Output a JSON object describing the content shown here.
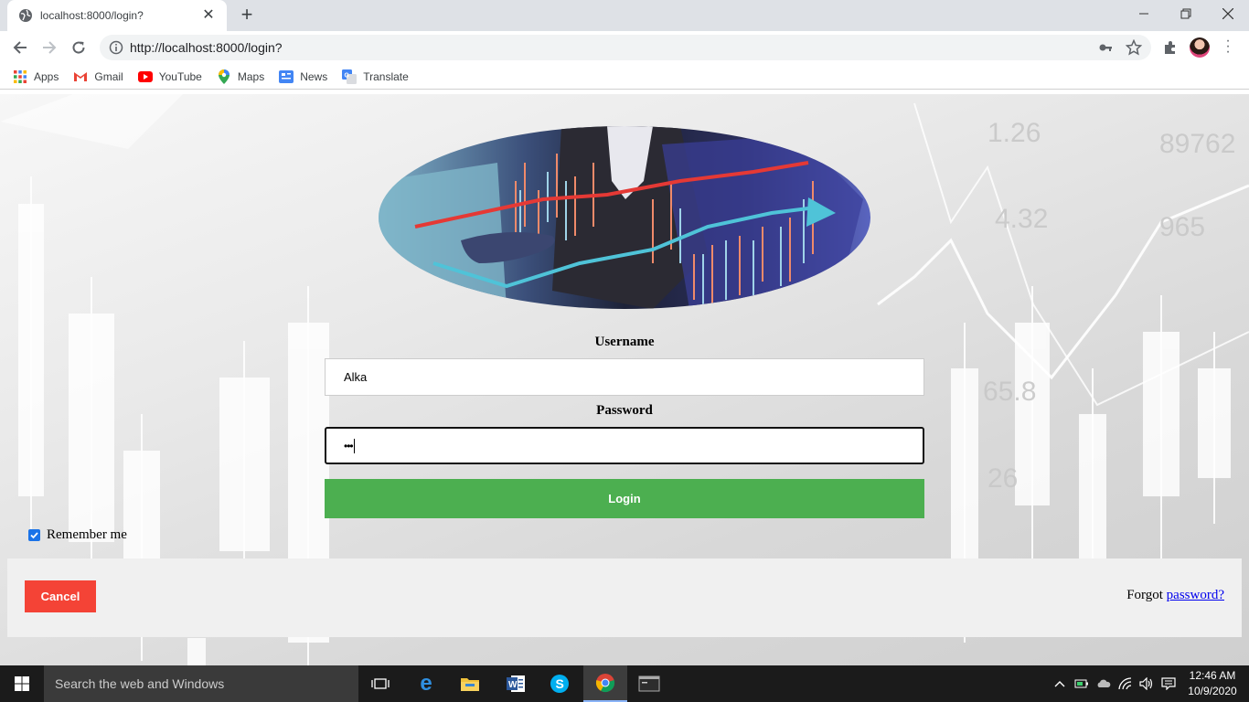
{
  "browser": {
    "tab_title": "localhost:8000/login?",
    "new_tab_symbol": "+",
    "url": "http://localhost:8000/login?",
    "bookmarks": [
      {
        "label": "Apps",
        "icon": "apps-grid-icon"
      },
      {
        "label": "Gmail",
        "icon": "gmail-icon"
      },
      {
        "label": "YouTube",
        "icon": "youtube-icon"
      },
      {
        "label": "Maps",
        "icon": "maps-pin-icon"
      },
      {
        "label": "News",
        "icon": "news-icon"
      },
      {
        "label": "Translate",
        "icon": "translate-icon"
      }
    ]
  },
  "login": {
    "username_label": "Username",
    "username_value": "Alka",
    "password_label": "Password",
    "password_value": "•••",
    "login_button": "Login",
    "remember_label": "Remember me",
    "remember_checked": true,
    "cancel_button": "Cancel",
    "forgot_prefix": "Forgot ",
    "forgot_link": "password?"
  },
  "background_numbers": [
    "1.26",
    "89762",
    "965",
    "4.32",
    "65.8",
    "26"
  ],
  "taskbar": {
    "search_placeholder": "Search the web and Windows",
    "time": "12:46 AM",
    "date": "10/9/2020"
  },
  "colors": {
    "login_green": "#4caf50",
    "cancel_red": "#f44336",
    "link_blue": "#0000ee",
    "taskbar": "#1b1b1b"
  }
}
